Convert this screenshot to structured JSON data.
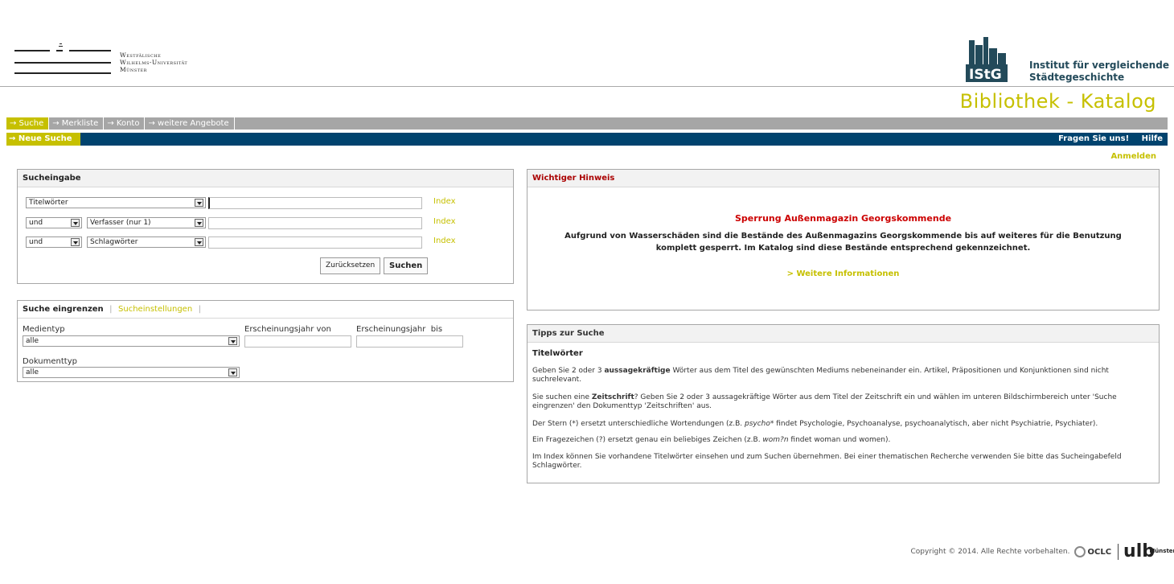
{
  "header": {
    "university_lines": [
      "Westfälische",
      "Wilhelms-Universität",
      "Münster"
    ],
    "institute_logo_text": "IStG",
    "institute_lines": [
      "Institut für vergleichende",
      "Städtegeschichte"
    ],
    "catalog_title": "Bibliothek - Katalog"
  },
  "nav": {
    "main": [
      {
        "label": "→ Suche",
        "active": true
      },
      {
        "label": "→ Merkliste",
        "active": false
      },
      {
        "label": "→ Konto",
        "active": false
      },
      {
        "label": "→ weitere Angebote",
        "active": false
      }
    ],
    "sub_active": "→ Neue Suche",
    "help_question": "Fragen Sie uns!",
    "help": "Hilfe",
    "login": "Anmelden"
  },
  "search": {
    "title": "Sucheingabe",
    "rows": [
      {
        "operator": "",
        "field": "Titelwörter",
        "value": "",
        "index": "Index"
      },
      {
        "operator": "und",
        "field": "Verfasser (nur 1)",
        "value": "",
        "index": "Index"
      },
      {
        "operator": "und",
        "field": "Schlagwörter",
        "value": "",
        "index": "Index"
      }
    ],
    "reset_label": "Zurücksetzen",
    "submit_label": "Suchen"
  },
  "restrict": {
    "title": "Suche eingrenzen",
    "settings_tab": "Sucheinstellungen",
    "media_label": "Medientyp",
    "media_value": "alle",
    "year_from_label": "Erscheinungsjahr von",
    "year_to_label": "Erscheinungsjahr  bis",
    "doc_label": "Dokumenttyp",
    "doc_value": "alle"
  },
  "notice": {
    "title": "Wichtiger Hinweis",
    "heading": "Sperrung Außenmagazin Georgskommende",
    "body": "Aufgrund von Wasserschäden sind die Bestände des Außenmagazins Georgskommende bis auf weiteres für die Benutzung komplett gesperrt. Im Katalog sind diese Bestände entsprechend gekennzeichnet.",
    "link": "> Weitere Informationen"
  },
  "tips": {
    "title": "Tipps zur Suche",
    "subtitle": "Titelwörter",
    "p1_a": "Geben Sie 2 oder 3 ",
    "p1_b": "aussagekräftige",
    "p1_c": " Wörter aus dem Titel des gewünschten Mediums nebeneinander ein. Artikel, Präpositionen und Konjunktionen sind nicht suchrelevant.",
    "p2_a": "Sie suchen eine ",
    "p2_b": "Zeitschrift",
    "p2_c": "? Geben Sie 2 oder 3 aussagekräftige Wörter aus dem Titel der Zeitschrift ein und wählen im unteren Bildschirmbereich unter 'Suche eingrenzen' den Dokumenttyp 'Zeitschriften' aus.",
    "p3_a": "Der Stern (*) ersetzt unterschiedliche Wortendungen (z.B. ",
    "p3_b": "psycho*",
    "p3_c": " findet Psychologie, Psychoanalyse, psychoanalytisch, aber nicht Psychiatrie, Psychiater).",
    "p4_a": "Ein Fragezeichen (?) ersetzt genau ein beliebiges Zeichen (z.B. ",
    "p4_b": "wom?n",
    "p4_c": " findet woman und women).",
    "p5": "Im Index können Sie vorhandene Titelwörter einsehen und zum Suchen übernehmen. Bei einer thematischen Recherche verwenden Sie bitte das Sucheingabefeld Schlagwörter."
  },
  "footer": {
    "copyright": "Copyright © 2014. Alle Rechte vorbehalten.",
    "oclc": "OCLC",
    "ulb": "ulb",
    "ulb_sub": "Münster"
  }
}
